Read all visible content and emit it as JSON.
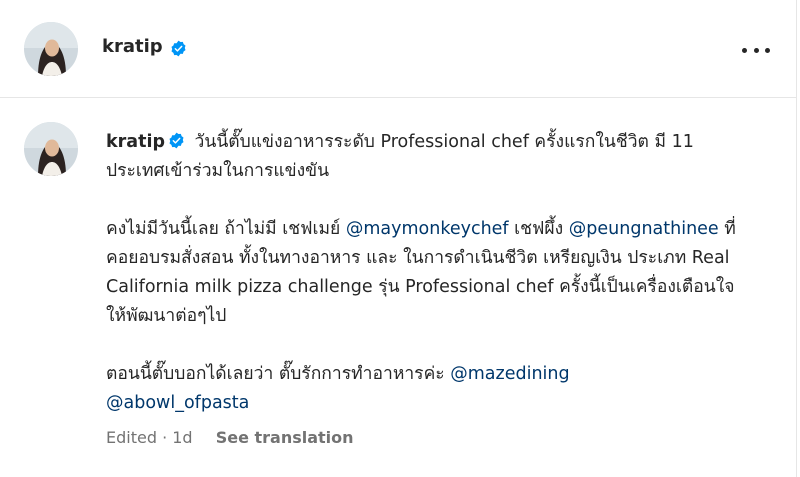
{
  "post": {
    "username": "kratip",
    "verified": true,
    "more_icon": "more-horizontal-icon"
  },
  "caption": {
    "username": "kratip",
    "line1_text": " วันนี้ตั๊บแข่งอาหารระดับ Professional chef ครั้งแรกในชีวิต มี 11 ประเทศเข้าร่วมในการแข่งขัน",
    "p2_a": "คงไม่มีวันนี้เลย ถ้าไม่มี เชฟเมย์ ",
    "p2_mention1": "@maymonkeychef",
    "p2_b": " เชฟผึ้ง ",
    "p2_mention2": "@peungnathinee",
    "p2_c": " ที่คอยอบรมสั่งสอน ทั้งในทางอาหาร และ ในการดำเนินชีวิต เหรียญเงิน ประเภท Real California milk pizza challenge รุ่น Professional chef ครั้งนี้เป็นเครื่องเตือนใจ ให้พัฒนาต่อๆไป",
    "p3_a": "ตอนนี้ตั๊บบอกได้เลยว่า ตั๊บรักการทำอาหารค่ะ ",
    "p3_mention1": "@mazedining",
    "p3_mention2": "@abowl_ofpasta"
  },
  "meta": {
    "edited_label": "Edited",
    "separator": " · ",
    "time_ago": "1d",
    "see_translation": "See translation"
  },
  "colors": {
    "verified_blue": "#0095f6",
    "mention": "#00376b",
    "secondary_text": "#737373",
    "divider": "#e6e6e6"
  }
}
